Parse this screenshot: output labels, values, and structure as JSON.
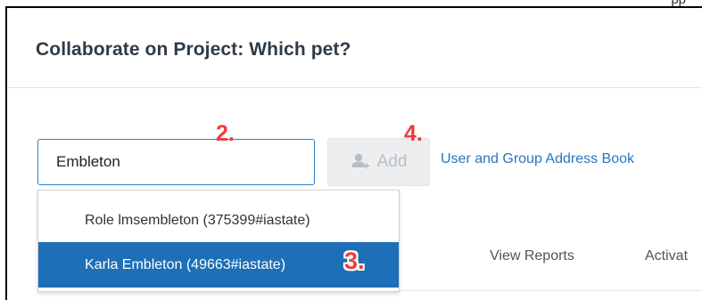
{
  "top_strip": {
    "text": "pp"
  },
  "dialog": {
    "title": "Collaborate on Project: Which pet?"
  },
  "search": {
    "value": "Embleton",
    "placeholder": ""
  },
  "add_button": {
    "label": "Add",
    "icon": "add-user-icon",
    "enabled": false
  },
  "address_book_link": {
    "label": "User and Group Address Book"
  },
  "dropdown": {
    "options": [
      {
        "label": "Role lmsembleton (375399#iastate)",
        "selected": false
      },
      {
        "label": "Karla Embleton (49663#iastate)",
        "selected": true
      }
    ]
  },
  "tabs": [
    {
      "label": "View Reports"
    },
    {
      "label": "Activat"
    }
  ],
  "annotations": {
    "step2": "2.",
    "step3": "3.",
    "step4": "4."
  },
  "colors": {
    "accent_blue": "#1d6fb7",
    "link_blue": "#2a76bd",
    "annotation_red": "#ef3b3b",
    "title_text": "#2f3b47"
  }
}
